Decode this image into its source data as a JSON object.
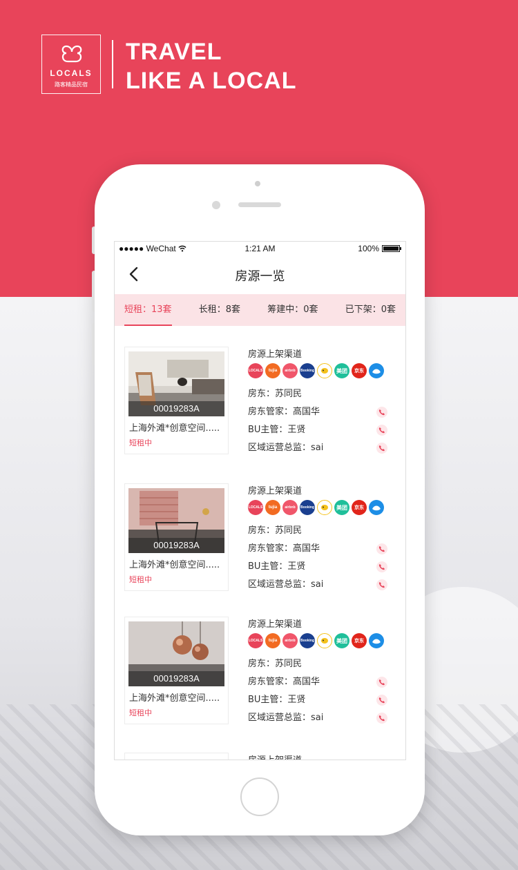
{
  "brand": {
    "logo_word": "LOCALS",
    "logo_sub": "路客精品民宿",
    "tagline_line1": "TRAVEL",
    "tagline_line2": "LIKE A LOCAL",
    "accent_color": "#e8445a"
  },
  "status_bar": {
    "carrier": "●●●●● WeChat",
    "time": "1:21 AM",
    "battery": "100%",
    "battery_level": 1.0
  },
  "nav": {
    "title": "房源一览"
  },
  "tabs": [
    {
      "label": "短租：13套",
      "active": true
    },
    {
      "label": "长租：8套",
      "active": false
    },
    {
      "label": "筹建中：0套",
      "active": false
    },
    {
      "label": "已下架：0套",
      "active": false
    }
  ],
  "channels": [
    {
      "name": "locals",
      "label": "LOCALS",
      "color": "#e8445a"
    },
    {
      "name": "tujia",
      "label": "tujia",
      "color": "#f26b22"
    },
    {
      "name": "airbnb",
      "label": "airbnb",
      "color": "#f0566a"
    },
    {
      "name": "booking",
      "label": "Booking",
      "color": "#1a3f8f"
    },
    {
      "name": "xiaozhu",
      "label": "",
      "color": "#f5c21b"
    },
    {
      "name": "meituan",
      "label": "美团",
      "color": "#1fbf9a"
    },
    {
      "name": "jd",
      "label": "京东",
      "color": "#e1251b"
    },
    {
      "name": "qunar",
      "label": "",
      "color": "#1d8ee6"
    }
  ],
  "listings": [
    {
      "code": "00019283A",
      "title": "上海外滩*创意空间.....",
      "status": "短租中",
      "channel_title": "房源上架渠道",
      "landlord": "房东：苏同民",
      "manager": "房东管家：高国华",
      "bu": "BU主管：王贤",
      "region": "区域运营总监：sai"
    },
    {
      "code": "00019283A",
      "title": "上海外滩*创意空间.....",
      "status": "短租中",
      "channel_title": "房源上架渠道",
      "landlord": "房东：苏同民",
      "manager": "房东管家：高国华",
      "bu": "BU主管：王贤",
      "region": "区域运营总监：sai"
    },
    {
      "code": "00019283A",
      "title": "上海外滩*创意空间.....",
      "status": "短租中",
      "channel_title": "房源上架渠道",
      "landlord": "房东：苏同民",
      "manager": "房东管家：高国华",
      "bu": "BU主管：王贤",
      "region": "区域运营总监：sai"
    },
    {
      "channel_title": "房源上架渠道"
    }
  ]
}
